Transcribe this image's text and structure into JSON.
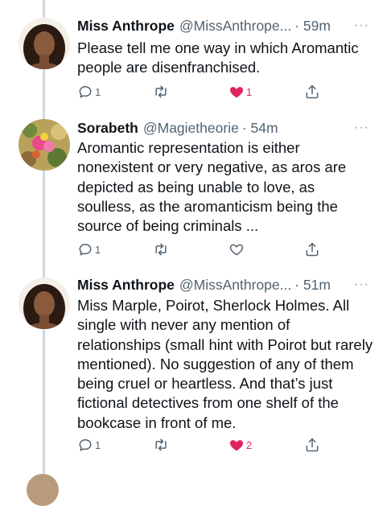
{
  "tweets": [
    {
      "name": "Miss Anthrope",
      "handle": "@MissAnthrope...",
      "time": "· 59m",
      "more": "···",
      "text": "Please tell me one way in which Aromantic people are disenfranchised.",
      "replies": "1",
      "retweets": "",
      "likes": "1",
      "liked": true
    },
    {
      "name": "Sorabeth",
      "handle": "@Magietheorie",
      "time": "· 54m",
      "more": "···",
      "text": "Aromantic representation is either nonexistent or very negative, as aros are depicted as being unable to love, as soulless, as the aromanticism being the source of being criminals ...",
      "replies": "1",
      "retweets": "",
      "likes": "",
      "liked": false
    },
    {
      "name": "Miss Anthrope",
      "handle": "@MissAnthrope...",
      "time": "· 51m",
      "more": "···",
      "text": "Miss Marple, Poirot, Sherlock Holmes. All single with never any mention of relationships (small hint with Poirot but rarely mentioned). No suggestion of any of them being cruel or heartless. And that’s just fictional detectives from one shelf of the bookcase in front of me.",
      "replies": "1",
      "retweets": "",
      "likes": "2",
      "liked": true
    }
  ],
  "colors": {
    "like_active": "#e0245e",
    "icon_gray": "#536471",
    "thread_line": "#cfd9de"
  }
}
